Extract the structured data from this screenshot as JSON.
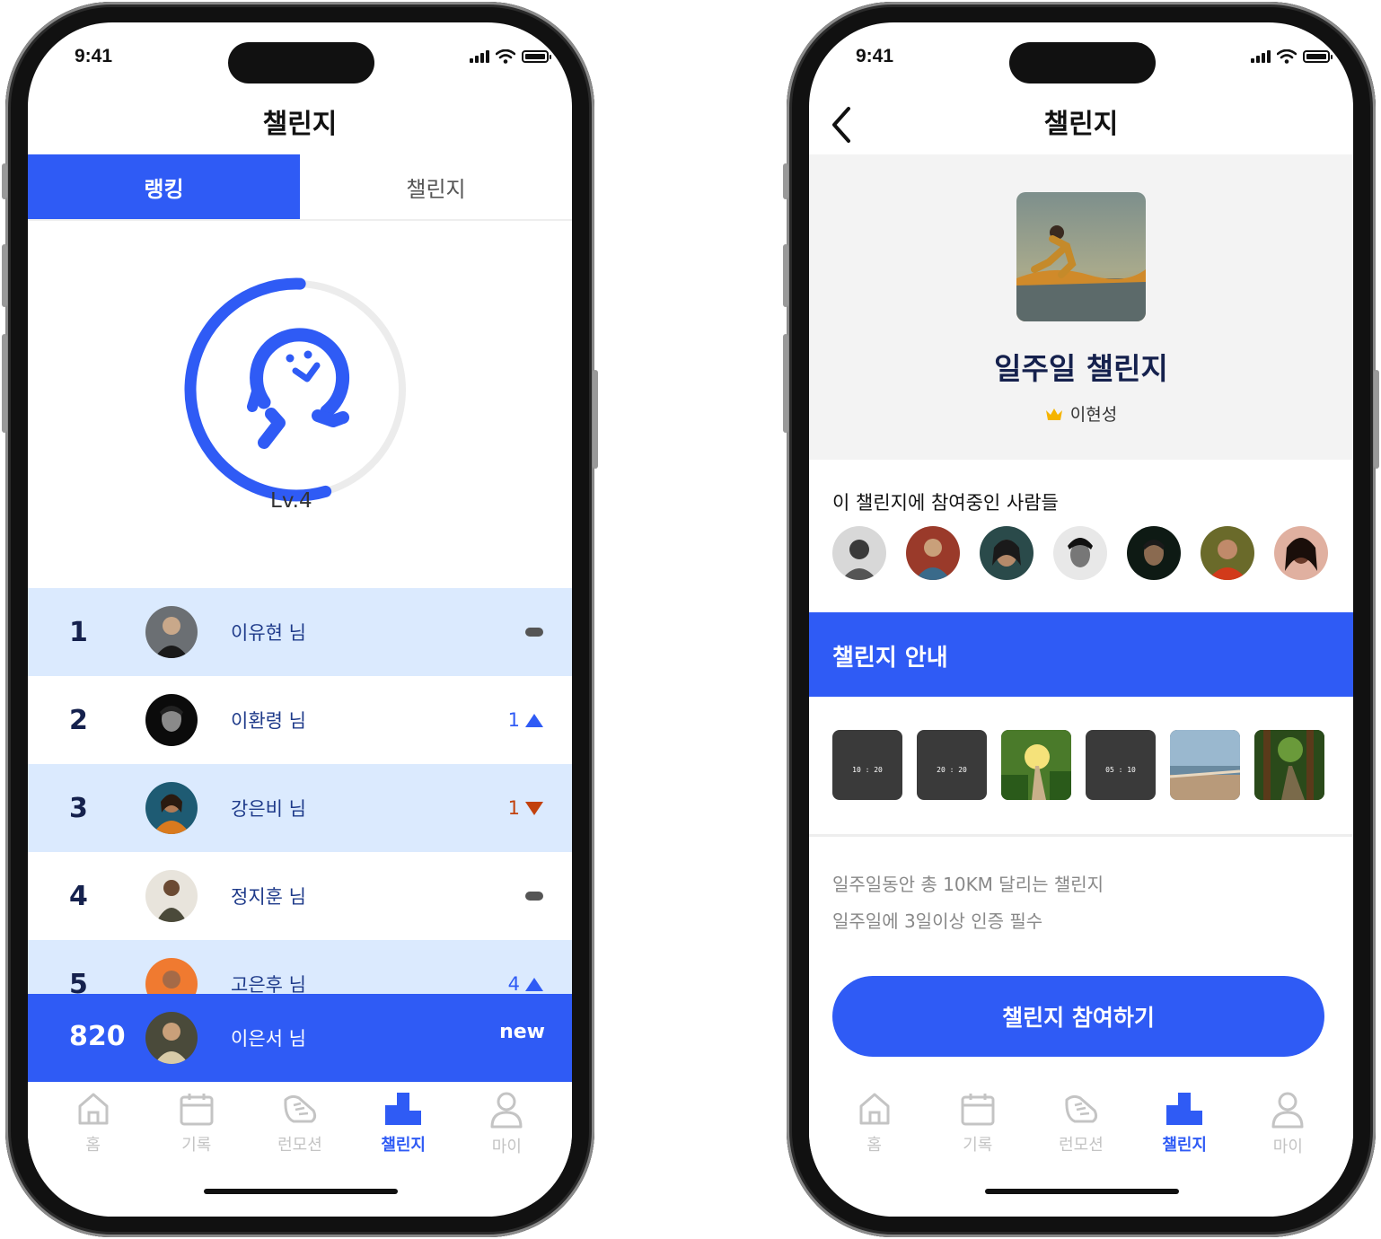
{
  "status": {
    "time": "9:41"
  },
  "left": {
    "title": "챌린지",
    "tabs": [
      {
        "label": "랭킹"
      },
      {
        "label": "챌린지"
      }
    ],
    "level": {
      "label": "Lv.4",
      "progress": 0.55
    },
    "ranking": [
      {
        "rank": "1",
        "name": "이유현 님",
        "change_value": "",
        "change": "same"
      },
      {
        "rank": "2",
        "name": "이환령 님",
        "change_value": "1",
        "change": "up"
      },
      {
        "rank": "3",
        "name": "강은비 님",
        "change_value": "1",
        "change": "down"
      },
      {
        "rank": "4",
        "name": "정지훈 님",
        "change_value": "",
        "change": "same"
      },
      {
        "rank": "5",
        "name": "고은후 님",
        "change_value": "4",
        "change": "up"
      }
    ],
    "my_rank": {
      "rank": "820",
      "name": "이은서 님",
      "status": "new"
    }
  },
  "right": {
    "title": "챌린지",
    "challenge_title": "일주일 챌린지",
    "owner": "이현성",
    "participants_label": "이 챌린지에 참여중인 사람들",
    "participant_count_shown": 7,
    "guide_label": "챌린지 안내",
    "thumbs": [
      {
        "type": "record",
        "value": "10 : 20"
      },
      {
        "type": "record",
        "value": "20 : 20"
      },
      {
        "type": "photo",
        "value": ""
      },
      {
        "type": "record",
        "value": "05 : 10"
      },
      {
        "type": "photo",
        "value": ""
      },
      {
        "type": "photo",
        "value": ""
      }
    ],
    "description": [
      "일주일동안 총 10KM 달리는 챌린지",
      "일주일에 3일이상 인증 필수"
    ],
    "join_button": "챌린지 참여하기"
  },
  "tabbar": [
    {
      "label": "홈",
      "icon": "home-icon"
    },
    {
      "label": "기록",
      "icon": "calendar-icon"
    },
    {
      "label": "런모션",
      "icon": "shoe-icon"
    },
    {
      "label": "챌린지",
      "icon": "podium-icon",
      "active": true
    },
    {
      "label": "마이",
      "icon": "user-icon"
    }
  ],
  "colors": {
    "accent": "#2f5bf5",
    "row_highlight": "#dbeafe",
    "navy": "#15214d",
    "down": "#c2410c"
  }
}
